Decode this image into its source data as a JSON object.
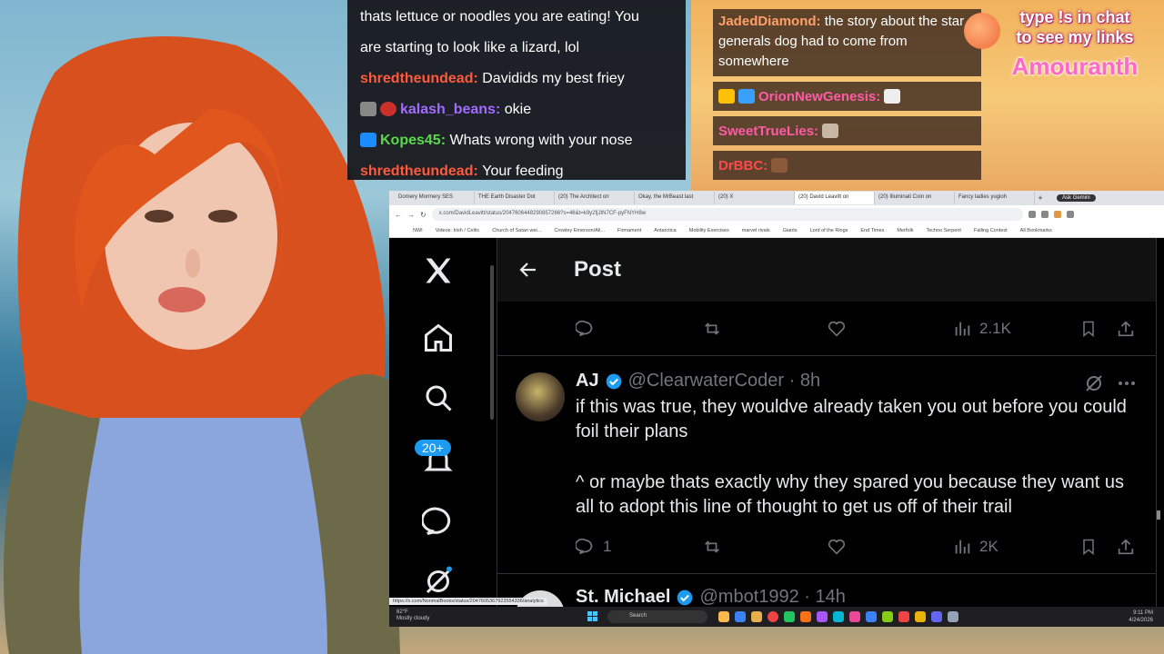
{
  "chat_left": [
    {
      "user": "",
      "text": "thats lettuce or noodles you are eating! You",
      "color": "#ffffff"
    },
    {
      "user": "",
      "text": "are starting to look like a lizard, lol",
      "color": "#ffffff"
    },
    {
      "user": "shredtheundead",
      "text": "Davidids my best friey",
      "color": "#ff5a3c"
    },
    {
      "user": "kalash_beans",
      "text": "okie",
      "color": "#a26bff"
    },
    {
      "user": "Kopes45",
      "text": "Whats wrong with your nose",
      "color": "#5bd94b"
    },
    {
      "user": "shredtheundead",
      "text": "Your feeding",
      "color": "#ff5a3c"
    }
  ],
  "chat_right": [
    {
      "user": "JadedDiamond",
      "text": "the story about the star generals dog had to come from somewhere"
    },
    {
      "user": "OrionNewGenesis",
      "text": ""
    },
    {
      "user": "SweetTrueLies",
      "text": ""
    },
    {
      "user": "DrBBC",
      "text": ""
    }
  ],
  "promo": {
    "line1": "type !s in chat",
    "line2": "to see my links",
    "brand": "Amouranth"
  },
  "browser": {
    "tabs": [
      "Domery Mormery SES",
      "THE Earth Disaster Dot",
      "(20) The Architect on",
      "Okay, the MrBeast last",
      "(20) X",
      "(20) David Leavitt on",
      "(20) Illuminati Coin on",
      "Fancy ladies yugioh"
    ],
    "gemini_label": "Ask Gemini",
    "url": "x.com/DavidLeavitt/status/2047606448290857266?s=46&t=k9y2fjJtN7CF-pyFNYH8w",
    "bookmarks": [
      "NWI",
      "Videos: Irish / Celtic",
      "Church of Satan wei...",
      "Crowley Emerson/Ali...",
      "Firmament",
      "Antarctica",
      "Mobility Exercises",
      "marvel rivals",
      "Giants",
      "Lord of the Rings",
      "End Times",
      "Merfolk",
      "Techno Serpent",
      "Falling Contest",
      "All Bookmarks"
    ]
  },
  "x": {
    "notif_count": "20+",
    "header_title": "Post",
    "top_views": "2.1K",
    "reply": {
      "name": "AJ",
      "handle": "@ClearwaterCoder · 8h",
      "line1": "if this was true, they wouldve already taken you out before you could foil their plans",
      "line2": "^ or maybe thats exactly why they spared you because they want us all to adopt this line of thought to get us off of their trail",
      "reply_count": "1",
      "views": "2K"
    },
    "next_reply": {
      "name": "St. Michael",
      "handle": "@mbot1992 · 14h"
    }
  },
  "taskbar": {
    "status_url": "https://x.com/NonmalBooks/status/2047605367923554336/analytics",
    "weather_temp": "82°F",
    "weather_desc": "Mostly cloudy",
    "search": "Search",
    "time": "9:11 PM",
    "date": "4/24/2026"
  }
}
